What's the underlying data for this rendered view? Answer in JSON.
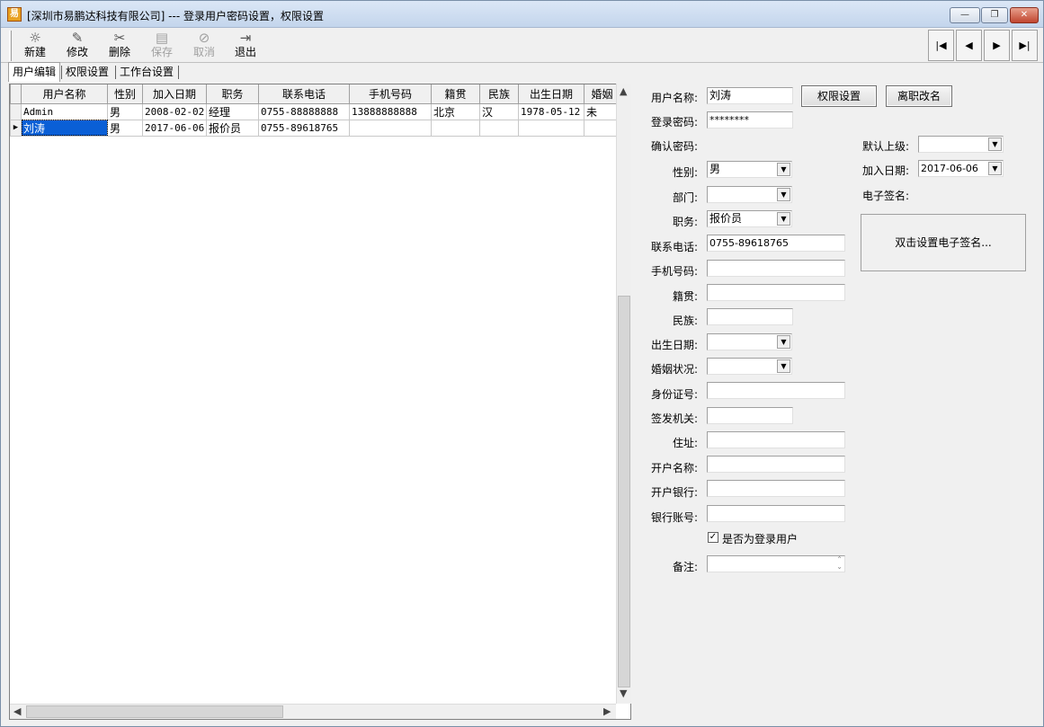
{
  "window": {
    "title": "[深圳市易鹏达科技有限公司] --- 登录用户密码设置，权限设置",
    "minimize": "—",
    "restore": "❐",
    "close": "✕"
  },
  "toolbar": {
    "buttons": [
      {
        "label": "新建",
        "icon": "☼",
        "icon_name": "new-icon",
        "enabled": true
      },
      {
        "label": "修改",
        "icon": "✎",
        "icon_name": "edit-icon",
        "enabled": true
      },
      {
        "label": "删除",
        "icon": "✂",
        "icon_name": "delete-icon",
        "enabled": true
      },
      {
        "label": "保存",
        "icon": "▤",
        "icon_name": "save-icon",
        "enabled": false
      },
      {
        "label": "取消",
        "icon": "⊘",
        "icon_name": "cancel-icon",
        "enabled": false
      },
      {
        "label": "退出",
        "icon": "⇥",
        "icon_name": "exit-icon",
        "enabled": true
      }
    ],
    "nav": [
      "|◀",
      "◀",
      "▶",
      "▶|"
    ]
  },
  "tabs": [
    "用户编辑",
    "权限设置",
    "工作台设置"
  ],
  "grid": {
    "columns": [
      "用户名称",
      "性别",
      "加入日期",
      "职务",
      "联系电话",
      "手机号码",
      "籍贯",
      "民族",
      "出生日期",
      "婚姻"
    ],
    "rows": [
      [
        "Admin",
        "男",
        "2008-02-02",
        "经理",
        "0755-88888888",
        "13888888888",
        "北京",
        "汉",
        "1978-05-12",
        "未"
      ],
      [
        "刘涛",
        "男",
        "2017-06-06",
        "报价员",
        "0755-89618765",
        "",
        "",
        "",
        "",
        ""
      ]
    ]
  },
  "form": {
    "username_label": "用户名称:",
    "username": "刘涛",
    "perm_button": "权限设置",
    "rename_button": "离职改名",
    "password_label": "登录密码:",
    "password": "********",
    "confirm_label": "确认密码:",
    "superior_label": "默认上级:",
    "superior": "",
    "gender_label": "性别:",
    "gender": "男",
    "join_label": "加入日期:",
    "join_date": "2017-06-06",
    "dept_label": "部门:",
    "dept": "",
    "signature_label": "电子签名:",
    "signature_hint": "双击设置电子签名...",
    "position_label": "职务:",
    "position": "报价员",
    "phone_label": "联系电话:",
    "phone": "0755-89618765",
    "mobile_label": "手机号码:",
    "native_label": "籍贯:",
    "ethnic_label": "民族:",
    "birth_label": "出生日期:",
    "marital_label": "婚姻状况:",
    "idno_label": "身份证号:",
    "issuer_label": "签发机关:",
    "address_label": "住址:",
    "acct_name_label": "开户名称:",
    "bank_label": "开户银行:",
    "acct_no_label": "银行账号:",
    "login_user_label": "是否为登录用户",
    "login_user_checked": true,
    "remark_label": "备注:"
  }
}
